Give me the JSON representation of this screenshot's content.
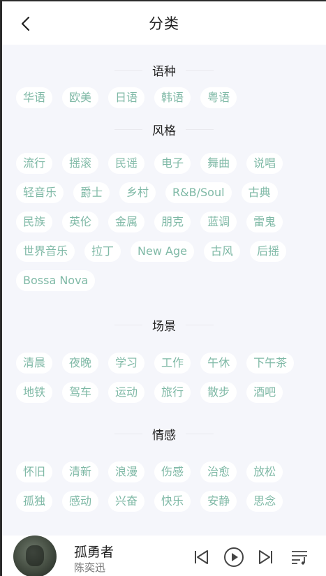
{
  "header": {
    "title": "分类"
  },
  "sections": [
    {
      "title": "语种",
      "tags": [
        "华语",
        "欧美",
        "日语",
        "韩语",
        "粤语"
      ]
    },
    {
      "title": "风格",
      "tags": [
        "流行",
        "摇滚",
        "民谣",
        "电子",
        "舞曲",
        "说唱",
        "轻音乐",
        "爵士",
        "乡村",
        "R&B/Soul",
        "古典",
        "民族",
        "英伦",
        "金属",
        "朋克",
        "蓝调",
        "雷鬼",
        "世界音乐",
        "拉丁",
        "New Age",
        "古风",
        "后摇",
        "Bossa Nova"
      ]
    },
    {
      "title": "场景",
      "tags": [
        "清晨",
        "夜晚",
        "学习",
        "工作",
        "午休",
        "下午茶",
        "地铁",
        "驾车",
        "运动",
        "旅行",
        "散步",
        "酒吧"
      ]
    },
    {
      "title": "情感",
      "tags": [
        "怀旧",
        "清新",
        "浪漫",
        "伤感",
        "治愈",
        "放松",
        "孤独",
        "感动",
        "兴奋",
        "快乐",
        "安静",
        "思念"
      ]
    }
  ],
  "player": {
    "song_title": "孤勇者",
    "artist": "陈奕迅"
  },
  "colors": {
    "accent_tag_text": "#7fb9a6",
    "background": "#f5f6fb"
  }
}
